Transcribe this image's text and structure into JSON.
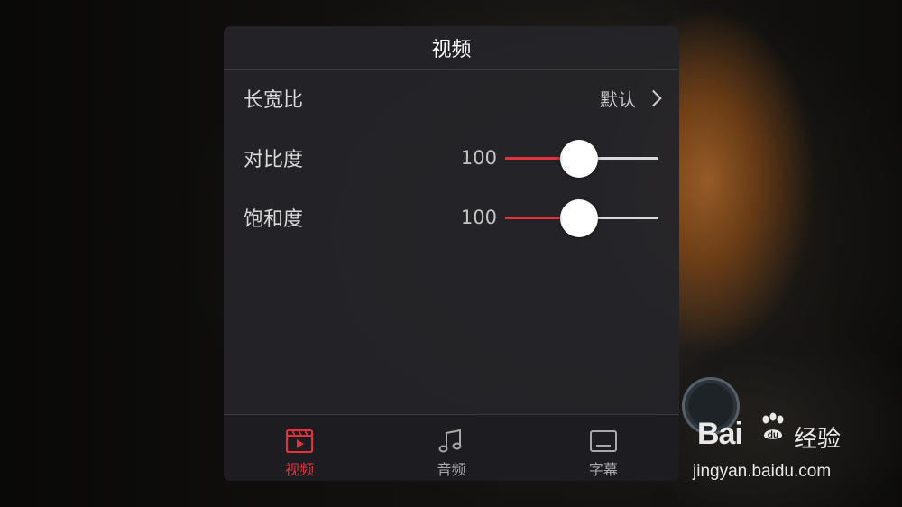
{
  "panel": {
    "title": "视频",
    "rows": {
      "aspect": {
        "label": "长宽比",
        "value": "默认"
      },
      "contrast": {
        "label": "对比度",
        "value": "100",
        "level": 0.48
      },
      "saturation": {
        "label": "饱和度",
        "value": "100",
        "level": 0.48
      }
    }
  },
  "tabs": [
    {
      "label": "视频",
      "icon": "video-clapper-icon",
      "active": true
    },
    {
      "label": "音频",
      "icon": "music-note-icon",
      "active": false
    },
    {
      "label": "字幕",
      "icon": "subtitle-icon",
      "active": false
    }
  ],
  "colors": {
    "accent": "#e3313d",
    "panel": "#242428",
    "text": "#d8d8d8"
  },
  "watermark": {
    "logo": "Bai",
    "brand": "经验",
    "url": "jingyan.baidu.com"
  }
}
